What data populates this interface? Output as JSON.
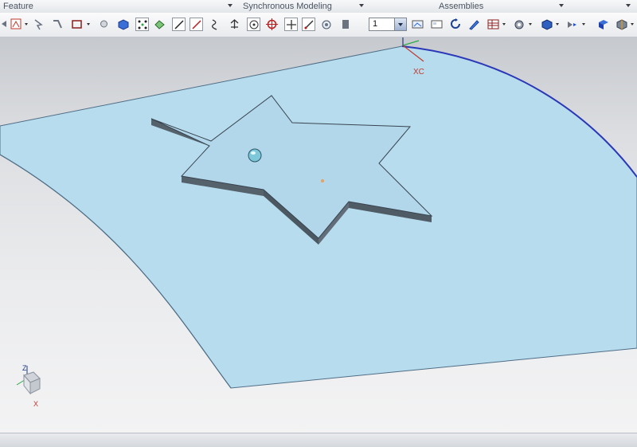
{
  "ribbon_groups": [
    {
      "label": "Feature"
    },
    {
      "label": "Synchronous Modeling"
    },
    {
      "label": "Assemblies"
    }
  ],
  "toolbar": {
    "layer_value": "1",
    "icons": [
      "scroll-left-icon",
      "sketch-icon",
      "move-face-icon",
      "pull-face-icon",
      "rectangle-icon",
      "lightbulb-icon",
      "block-icon",
      "pattern-icon",
      "mesh-icon",
      "line-icon",
      "arc-icon",
      "spline-icon",
      "arrow-up-icon",
      "point-circle-icon",
      "circle-target-icon",
      "crosshair-icon",
      "point-line-icon",
      "camera-icon",
      "layer-manager-icon",
      "image-icon",
      "rotate-icon",
      "pencil-icon",
      "grid-table-icon",
      "wcs-icon",
      "cube-icon",
      "view-icon",
      "part-navigator-icon",
      "assembly-icon"
    ]
  },
  "viewport": {
    "wcs_label": "XC",
    "triad_z": "Z",
    "triad_x": "X",
    "colors": {
      "surface_fill": "#b7dcee",
      "surface_edge": "#4f6e86",
      "surface_curve": "#2a38b8",
      "star_side": "#55616b",
      "star_top": "#b3d7ea"
    }
  },
  "status": {
    "message": ""
  }
}
